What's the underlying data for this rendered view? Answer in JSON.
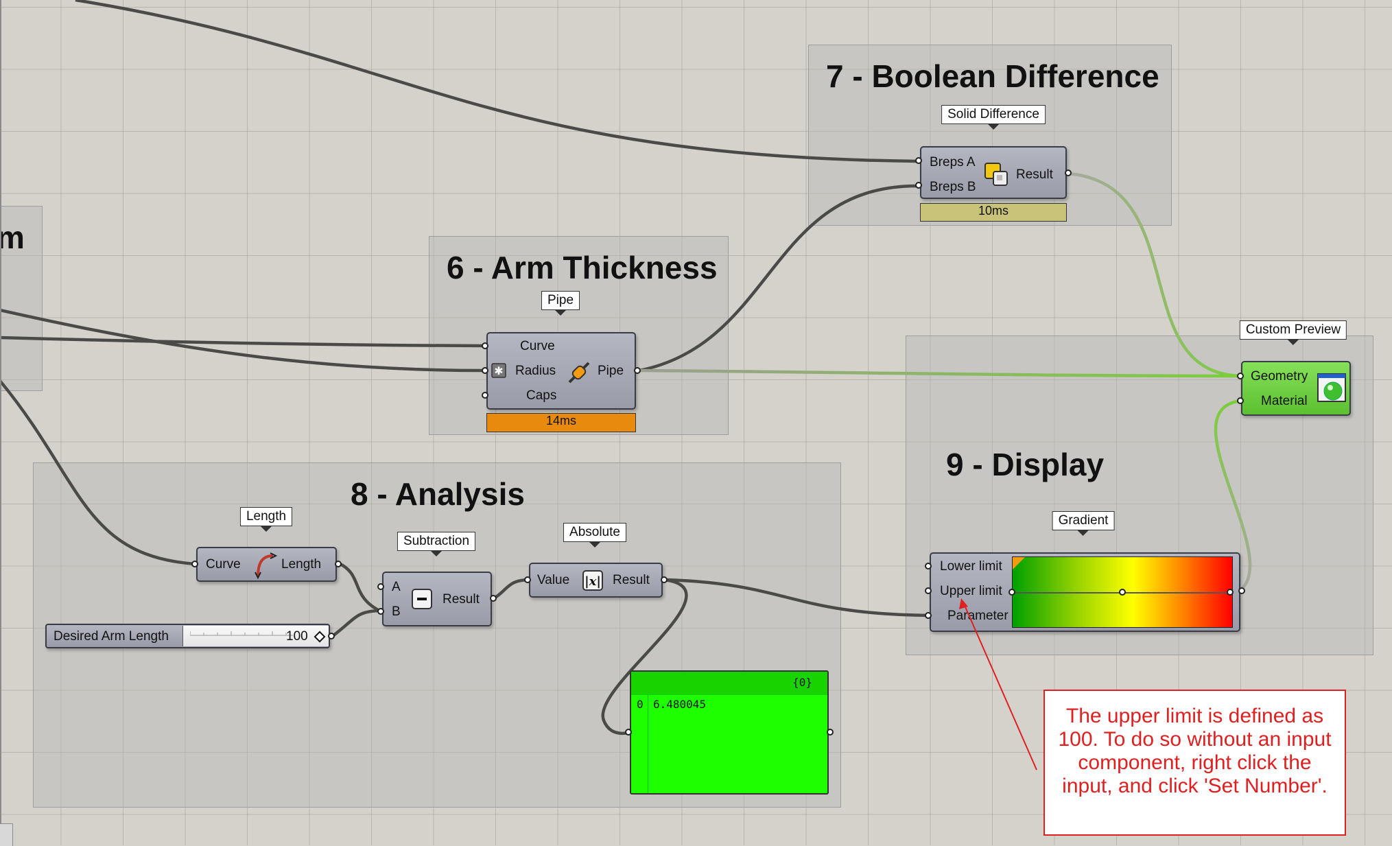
{
  "groups": {
    "g5": {
      "title": "m"
    },
    "g6": {
      "title": "6 - Arm Thickness"
    },
    "g7": {
      "title": "7 - Boolean Difference"
    },
    "g8": {
      "title": "8 - Analysis"
    },
    "g9": {
      "title": "9 - Display"
    }
  },
  "components": {
    "solid_difference": {
      "tag": "Solid Difference",
      "in1": "Breps A",
      "in2": "Breps B",
      "out": "Result",
      "timer": "10ms",
      "icon": "solid-difference-icon"
    },
    "pipe": {
      "tag": "Pipe",
      "in1": "Curve",
      "in2": "Radius",
      "in3": "Caps",
      "out": "Pipe",
      "timer": "14ms",
      "icon": "pipe-icon"
    },
    "length": {
      "tag": "Length",
      "in": "Curve",
      "out": "Length",
      "icon": "curve-length-icon"
    },
    "subtraction": {
      "tag": "Subtraction",
      "in1": "A",
      "in2": "B",
      "out": "Result",
      "icon": "minus-icon"
    },
    "absolute": {
      "tag": "Absolute",
      "in": "Value",
      "out": "Result",
      "icon": "absolute-value-icon"
    },
    "slider": {
      "label": "Desired Arm Length",
      "value": "100",
      "level": 1.0
    },
    "panel": {
      "header": "{0}",
      "index": "0",
      "value": "6.480045"
    },
    "gradient": {
      "tag": "Gradient",
      "in1": "Lower limit",
      "in2": "Upper limit",
      "in3": "Parameter"
    },
    "custom_preview": {
      "tag": "Custom Preview",
      "in1": "Geometry",
      "in2": "Material",
      "icon": "preview-sphere-icon"
    }
  },
  "annotation": {
    "text": "The upper limit is defined as 100. To do so without an input component, right click the input, and click 'Set Number'."
  },
  "colors": {
    "timer_fast": "#c9c37a",
    "timer_slow": "#e88a0e",
    "panel_bg": "#1eff00",
    "preview_bg": "#6fd243",
    "wire": "#4a4a48",
    "wire_selected": "#7ccd3c",
    "annotation": "#e02020"
  }
}
